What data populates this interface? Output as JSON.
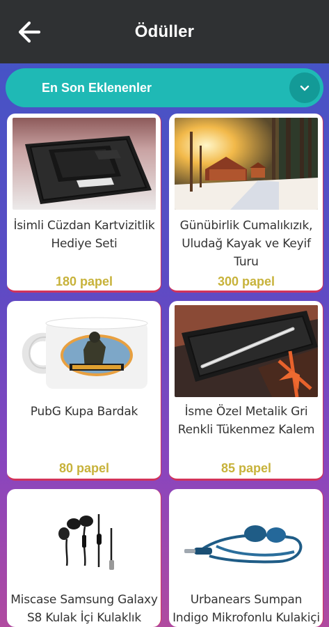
{
  "header": {
    "title": "Ödüller",
    "back_icon": "arrow-left-icon"
  },
  "filter": {
    "label": "En Son Eklenenler",
    "toggle_icon": "chevron-down-icon"
  },
  "colors": {
    "header_bg": "#2f3133",
    "accent": "#1fb9b5",
    "price": "#c7b23a",
    "card_border": "#d2335a"
  },
  "rewards": [
    {
      "name": "İsimli Cüzdan Kartvizitlik Hediye Seti",
      "price": "180 papel",
      "image": "wallet-card-holder-gift-set"
    },
    {
      "name": "Günübirlik Cumalıkızık, Uludağ Kayak ve Keyif Turu",
      "price": "300 papel",
      "image": "snowy-forest-cabin"
    },
    {
      "name": "PubG Kupa Bardak",
      "price": "80 papel",
      "image": "pubg-mug"
    },
    {
      "name": "İsme Özel Metalik Gri Renkli Tükenmez Kalem",
      "price": "85 papel",
      "image": "metallic-pen-gift-box"
    },
    {
      "name": "Miscase Samsung Galaxy S8 Kulak İçi Kulaklık",
      "price": "",
      "image": "black-earphones"
    },
    {
      "name": "Urbanears Sumpan Indigo Mikrofonlu Kulakiçi",
      "price": "",
      "image": "blue-earphones"
    }
  ]
}
